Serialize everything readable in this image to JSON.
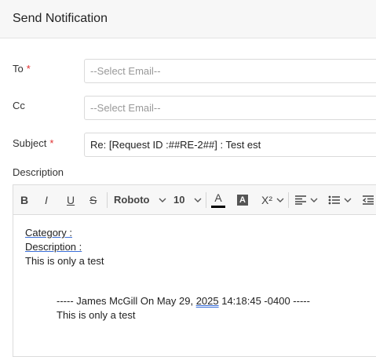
{
  "dialog": {
    "title": "Send Notification"
  },
  "form": {
    "to": {
      "label": "To",
      "required_mark": "*",
      "placeholder": "--Select Email--"
    },
    "cc": {
      "label": "Cc",
      "placeholder": "--Select Email--"
    },
    "subject": {
      "label": "Subject",
      "required_mark": "*",
      "value": "Re: [Request ID :##RE-2##] : Test est"
    },
    "description": {
      "label": "Description"
    }
  },
  "toolbar": {
    "bold": "B",
    "italic": "I",
    "underline": "U",
    "strike": "S",
    "font_family": "Roboto",
    "font_size": "10",
    "text_color_glyph": "A",
    "highlight_glyph": "A",
    "superscript_glyph": "X²",
    "text_color_hex": "#000000"
  },
  "editor": {
    "line1": "Category :",
    "line2": "Description :",
    "line3": "This is only a test",
    "quote_prefix": "----- James McGill On May 29, ",
    "quote_year": "2025",
    "quote_suffix": " 14:18:45 -0400 -----",
    "quote_body": "This is only a test"
  }
}
